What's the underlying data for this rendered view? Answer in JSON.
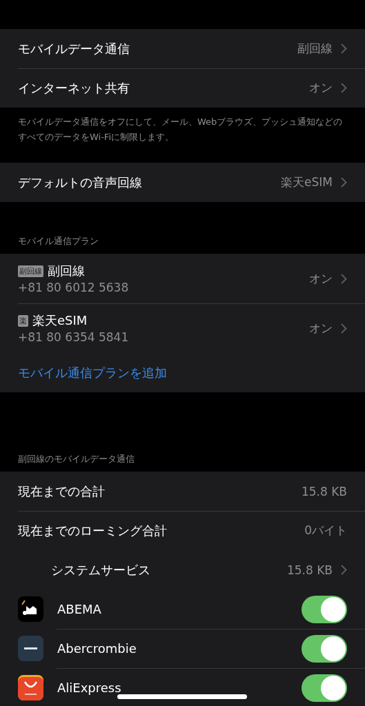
{
  "group_1": {
    "rows": [
      {
        "label": "モバイルデータ通信",
        "value": "副回線"
      },
      {
        "label": "インターネット共有",
        "value": "オン"
      }
    ],
    "footer": "モバイルデータ通信をオフにして、メール、Webブラウズ、プッシュ通知などのすべてのデータをWi-Fiに制限します。"
  },
  "group_2": {
    "rows": [
      {
        "label": "デフォルトの音声回線",
        "value": "楽天eSIM"
      }
    ]
  },
  "plans": {
    "header": "モバイル通信プラン",
    "items": [
      {
        "badge": "副回線",
        "name": "副回線",
        "number": "+81 80 6012 5638",
        "status": "オン"
      },
      {
        "badge": "楽",
        "name": "楽天eSIM",
        "number": "+81 80 6354 5841",
        "status": "オン"
      }
    ],
    "add_link": "モバイル通信プランを追加"
  },
  "usage": {
    "header": "副回線のモバイルデータ通信",
    "rows": [
      {
        "kind": "stat",
        "label": "現在までの合計",
        "value": "15.8 KB"
      },
      {
        "kind": "stat",
        "label": "現在までのローミング合計",
        "value": "0バイト"
      },
      {
        "kind": "service",
        "label": "システムサービス",
        "value": "15.8 KB"
      },
      {
        "kind": "app",
        "label": "ABEMA",
        "on": true
      },
      {
        "kind": "app",
        "label": "Abercrombie",
        "on": true
      },
      {
        "kind": "app",
        "label": "AliExpress",
        "on": true
      }
    ]
  }
}
